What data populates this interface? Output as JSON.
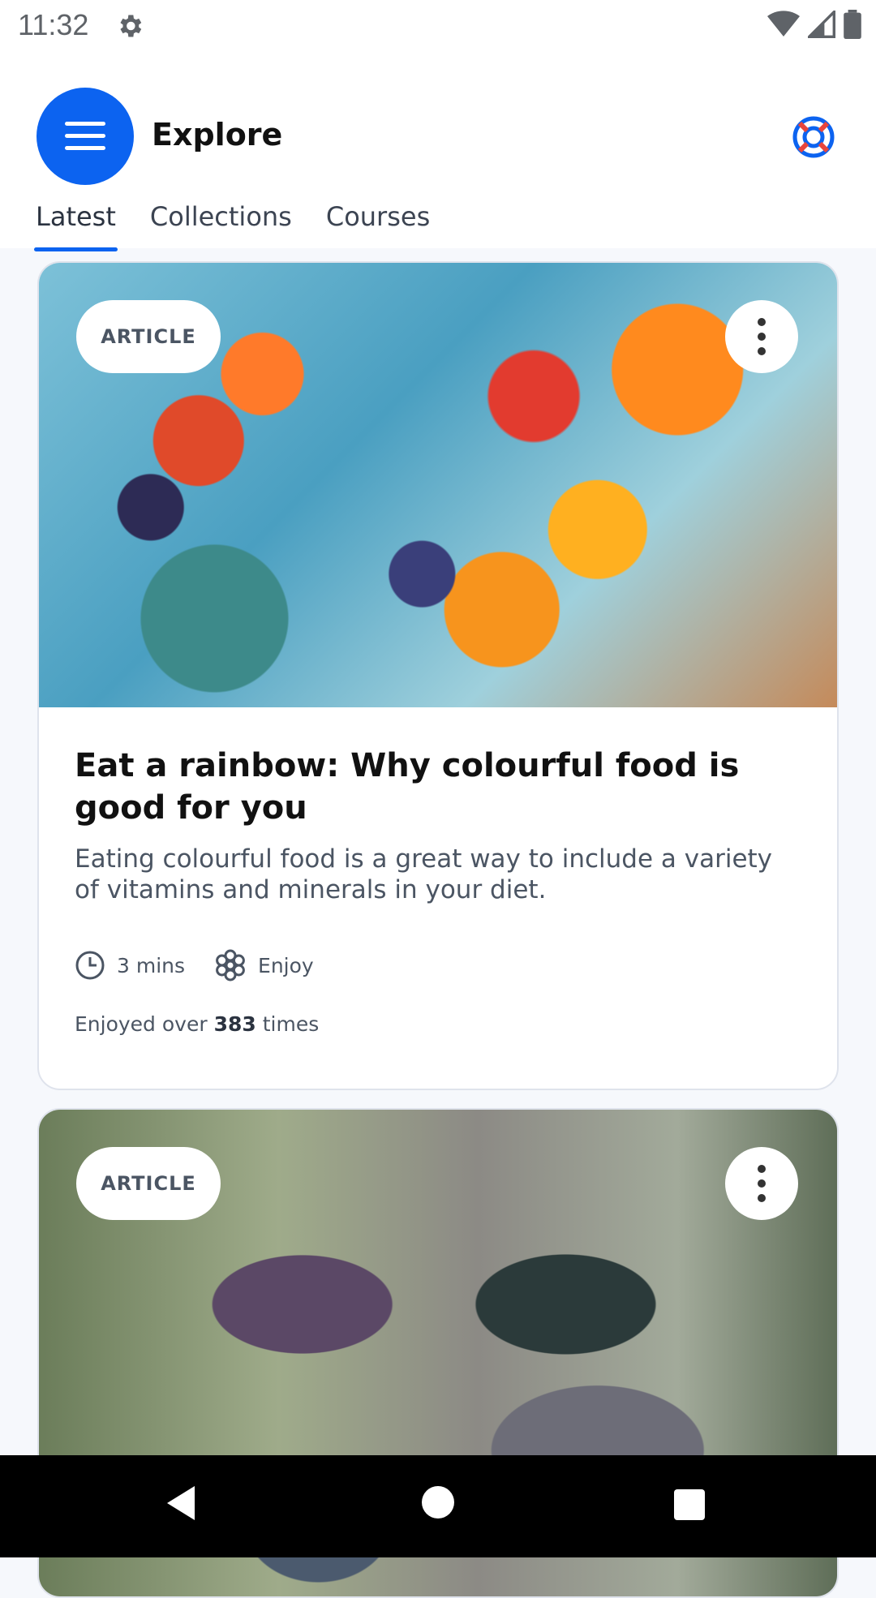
{
  "status_bar": {
    "time": "11:32"
  },
  "header": {
    "title": "Explore",
    "tabs": [
      {
        "label": "Latest",
        "active": true
      },
      {
        "label": "Collections",
        "active": false
      },
      {
        "label": "Courses",
        "active": false
      }
    ],
    "accent_color": "#0c63f0"
  },
  "cards": [
    {
      "badge": "ARTICLE",
      "title": "Eat a rainbow: Why colourful food is good for you",
      "description": "Eating colourful food is a great way to include a variety of vitamins and minerals in your diet.",
      "duration": "3 mins",
      "category": "Enjoy",
      "enjoyed_prefix": "Enjoyed over",
      "enjoyed_count": "383",
      "enjoyed_suffix": "times"
    },
    {
      "badge": "ARTICLE"
    }
  ],
  "icons": {
    "menu": "hamburger-icon",
    "help": "lifebuoy-icon",
    "more": "more-vertical-icon",
    "clock": "clock-icon",
    "category": "flower-icon"
  }
}
